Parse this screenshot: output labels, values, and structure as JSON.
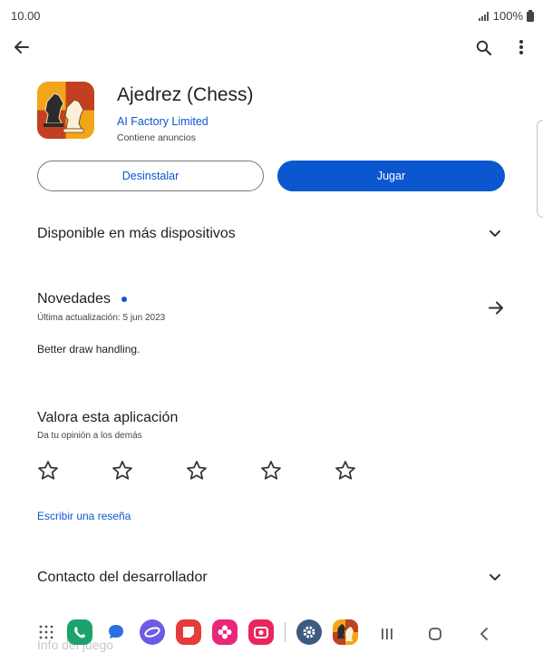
{
  "status": {
    "time": "10.00",
    "battery": "100%"
  },
  "app": {
    "title": "Ajedrez (Chess)",
    "developer": "AI Factory Limited",
    "ads_note": "Contiene anuncios"
  },
  "buttons": {
    "uninstall": "Desinstalar",
    "play": "Jugar"
  },
  "sections": {
    "devices": "Disponible en más dispositivos",
    "news_title": "Novedades",
    "news_date": "Última actualización: 5 jun 2023",
    "news_body": "Better draw handling.",
    "rate_title": "Valora esta aplicación",
    "rate_sub": "Da tu opinión a los demás",
    "rating": 0,
    "rating_max": 5,
    "write_review": "Escribir una reseña",
    "contact": "Contacto del desarrollador",
    "game_info": "Info del juego"
  },
  "colors": {
    "accent": "#0b57d0",
    "dock": [
      "#1aa36a",
      "#2c6fe0",
      "#6b5ce7",
      "#e63b3b",
      "#e8267a",
      "#e8265a",
      "#3d5a80"
    ]
  },
  "icons": {
    "back": "arrow-left-icon",
    "search": "search-icon",
    "more": "more-vert-icon",
    "chevron": "chevron-down-icon",
    "arrow": "arrow-right-icon",
    "star": "star-outline-icon"
  }
}
